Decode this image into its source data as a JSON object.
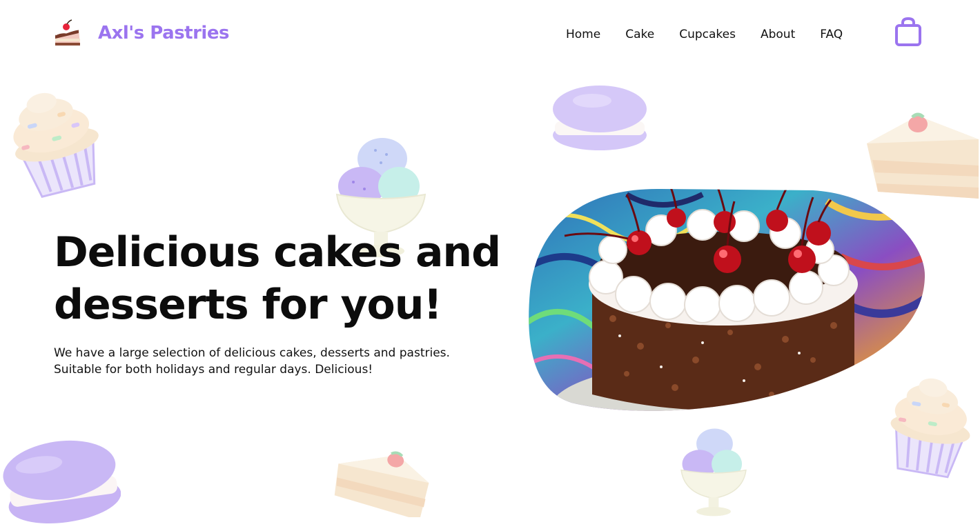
{
  "brand": {
    "name": "Axl's Pastries",
    "color": "#9b74ef",
    "logo_icon": "cake-slice-icon"
  },
  "nav": {
    "items": [
      {
        "label": "Home"
      },
      {
        "label": "Cake"
      },
      {
        "label": "Cupcakes"
      },
      {
        "label": "About"
      },
      {
        "label": "FAQ"
      }
    ],
    "cart_icon": "shopping-bag-icon"
  },
  "hero": {
    "title": "Delicious cakes and desserts for you!",
    "description": "We have a large selection of delicious cakes, desserts and pastries. Suitable for both holidays and regular days. Delicious!",
    "image": "black-forest-cake-photo"
  },
  "decorations": [
    "cupcake-icon",
    "macaron-icon",
    "ice-cream-cup-icon",
    "cake-slice-icon"
  ],
  "colors": {
    "accent": "#9b74ef",
    "lavender": "#c9b8f5",
    "cream": "#f6e6cf",
    "mint": "#b8ece4",
    "background": "#ffffff"
  }
}
